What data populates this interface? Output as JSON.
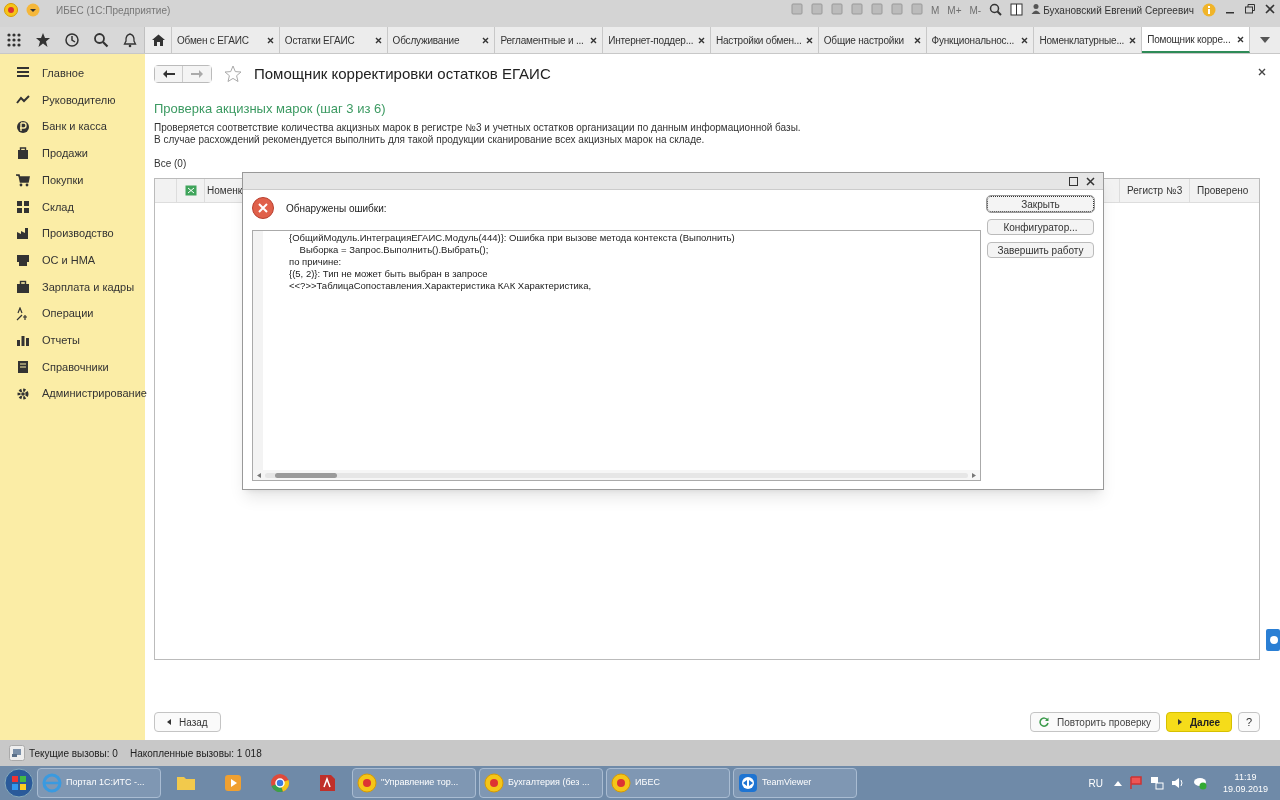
{
  "window": {
    "title": "ИБЕС (1С:Предприятие)",
    "user": "Бухановский Евгений Сергеевич",
    "memory_buttons": [
      "M",
      "M+",
      "M-"
    ]
  },
  "tabs": [
    {
      "label": "Обмен с ЕГАИС",
      "selected": false
    },
    {
      "label": "Остатки ЕГАИС",
      "selected": false
    },
    {
      "label": "Обслуживание",
      "selected": false
    },
    {
      "label": "Регламентные и ...",
      "selected": false
    },
    {
      "label": "Интернет-поддер...",
      "selected": false
    },
    {
      "label": "Настройки обмен...",
      "selected": false
    },
    {
      "label": "Общие настройки",
      "selected": false
    },
    {
      "label": "Функциональнос...",
      "selected": false
    },
    {
      "label": "Номенклатурные...",
      "selected": false
    },
    {
      "label": "Помощник корре...",
      "selected": true
    }
  ],
  "sidebar": {
    "items": [
      {
        "label": "Главное"
      },
      {
        "label": "Руководителю"
      },
      {
        "label": "Банк и касса"
      },
      {
        "label": "Продажи"
      },
      {
        "label": "Покупки"
      },
      {
        "label": "Склад"
      },
      {
        "label": "Производство"
      },
      {
        "label": "ОС и НМА"
      },
      {
        "label": "Зарплата и кадры"
      },
      {
        "label": "Операции"
      },
      {
        "label": "Отчеты"
      },
      {
        "label": "Справочники"
      },
      {
        "label": "Администрирование"
      }
    ]
  },
  "form": {
    "title": "Помощник корректировки остатков ЕГАИС",
    "step_title": "Проверка акцизных марок (шаг 3 из 6)",
    "description": [
      "Проверяется соответствие количества акцизных марок в регистре №3 и учетных остатков организации по данным информационной базы.",
      "В случае расхождений рекомендуется выполнить для такой продукции сканирование всех акцизных марок на складе."
    ],
    "filter": "Все (0)",
    "table": {
      "columns": [
        "Номенк",
        "Регистр №3",
        "Проверено"
      ]
    },
    "buttons": {
      "back": "Назад",
      "retry": "Повторить проверку",
      "next": "Далее",
      "help": "?"
    }
  },
  "dialog": {
    "title": "Обнаружены ошибки:",
    "lines": [
      "{ОбщийМодуль.ИнтеграцияЕГАИС.Модуль(444)}: Ошибка при вызове метода контекста (Выполнить)",
      "    Выборка = Запрос.Выполнить().Выбрать();",
      "по причине:",
      "{(5, 2)}: Тип не может быть выбран в запросе",
      "<<?>>ТаблицаСопоставления.Характеристика КАК Характеристика,"
    ],
    "buttons": [
      {
        "label": "Закрыть",
        "selected": true
      },
      {
        "label": "Конфигуратор...",
        "selected": false
      },
      {
        "label": "Завершить работу",
        "selected": false
      }
    ]
  },
  "status_bar": {
    "current_calls": "Текущие вызовы: 0",
    "accumulated_calls": "Накопленные вызовы: 1 018"
  },
  "taskbar": {
    "items": [
      {
        "label": "Портал 1С:ИТС -...",
        "kind": "ie"
      },
      {
        "kind": "folder"
      },
      {
        "kind": "media"
      },
      {
        "kind": "chrome"
      },
      {
        "kind": "acrobat"
      },
      {
        "label": "\"Управление тор...",
        "kind": "onec"
      },
      {
        "label": "Бухгалтерия (без ...",
        "kind": "onec"
      },
      {
        "label": "ИБЕС",
        "kind": "onec"
      },
      {
        "label": "TeamViewer",
        "kind": "teamviewer"
      }
    ],
    "language": "RU",
    "time": "11:19",
    "date": "19.09.2019"
  }
}
